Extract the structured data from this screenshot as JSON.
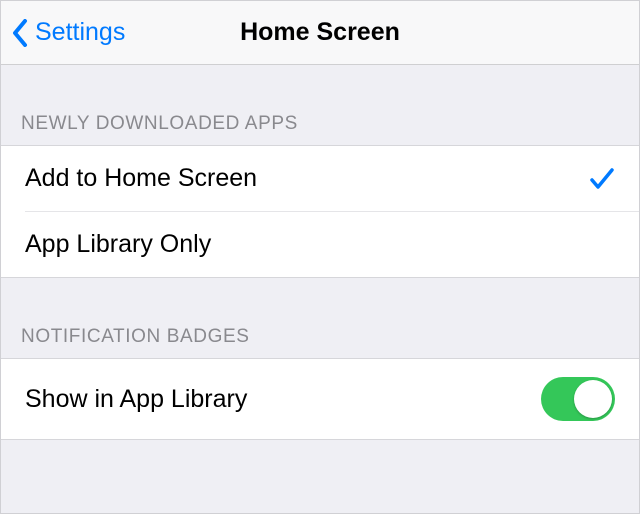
{
  "nav": {
    "back_label": "Settings",
    "title": "Home Screen"
  },
  "sections": {
    "new_apps": {
      "header": "NEWLY DOWNLOADED APPS",
      "opt_home": "Add to Home Screen",
      "opt_library": "App Library Only",
      "selected": "home"
    },
    "badges": {
      "header": "NOTIFICATION BADGES",
      "show_in_library": "Show in App Library",
      "show_in_library_on": true
    }
  },
  "colors": {
    "tint": "#007aff",
    "toggle_on": "#34c759",
    "bg": "#efeff4"
  }
}
